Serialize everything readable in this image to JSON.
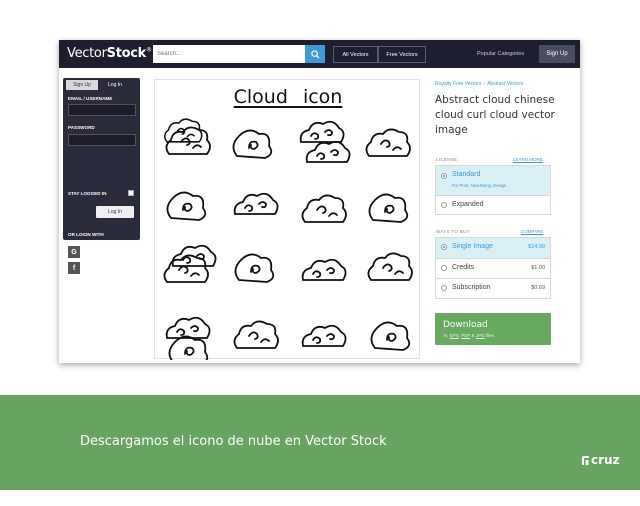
{
  "header": {
    "logo_light": "Vector",
    "logo_bold": "Stock",
    "logo_reg": "®",
    "search_placeholder": "Search...",
    "search_icon": "search-icon",
    "filter_all": "All Vectors",
    "filter_free": "Free Vectors",
    "popular": "Popular Categories",
    "signup": "Sign Up"
  },
  "login": {
    "tab_signup": "Sign Up",
    "tab_login": "Log In",
    "email_label": "EMAIL / USERNAME",
    "password_label": "PASSWORD",
    "stay_label": "STAY LOGGED IN",
    "login_button": "Log In",
    "or_login_with": "OR LOGIN WITH",
    "google": "Google",
    "facebook": "Facebook"
  },
  "image": {
    "title": "Cloud icon"
  },
  "breadcrumb": {
    "item1": "Royalty Free Vectors",
    "separator": "›",
    "item2": "Abstract Vectors"
  },
  "product": {
    "title": "Abstract cloud chinese cloud curl cloud vector image"
  },
  "license": {
    "heading": "LICENSE",
    "learn_more": "LEARN MORE",
    "standard": "Standard",
    "standard_sub": "For Print, Advertising, Design",
    "expanded": "Expanded"
  },
  "buy": {
    "heading": "WAYS TO BUY",
    "compare": "COMPARE",
    "options": [
      {
        "label": "Single Image",
        "price": "$14.99",
        "selected": true
      },
      {
        "label": "Credits",
        "price": "$1.00",
        "selected": false
      },
      {
        "label": "Subscription",
        "price": "$0.69",
        "selected": false
      }
    ]
  },
  "download": {
    "title": "Download",
    "formats_prefix": "AI, ",
    "format_eps": "EPS",
    "formats_sep": ", ",
    "format_pdf": "PDF",
    "formats_and": " & ",
    "format_jpg": "JPG",
    "formats_suffix": " files"
  },
  "banner": {
    "caption": "Descargamos el icono de nube en Vector Stock",
    "brand": "cruz"
  },
  "colors": {
    "topbar": "#1d1f2e",
    "accent": "#3d9ad6",
    "download": "#66a95f",
    "banner": "#67a45f"
  }
}
